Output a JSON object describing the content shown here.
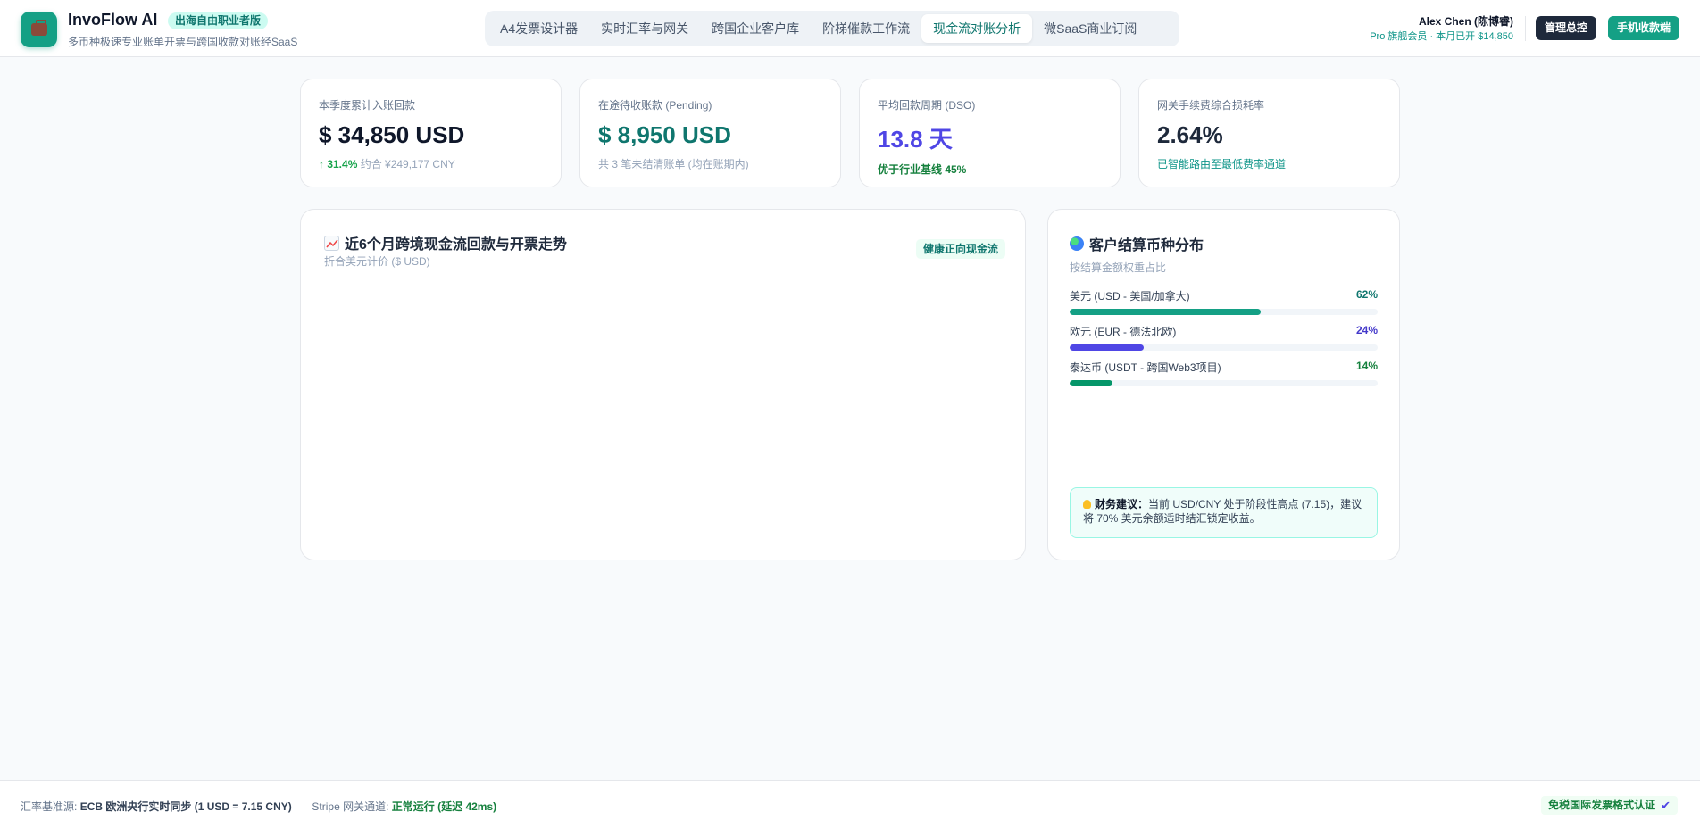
{
  "header": {
    "app_name": "InvoFlow AI",
    "edition_badge": "出海自由职业者版",
    "subtitle": "多币种极速专业账单开票与跨国收款对账经SaaS",
    "logo_icon": "briefcase-icon",
    "nav_tabs": [
      {
        "label": "A4发票设计器"
      },
      {
        "label": "实时汇率与网关"
      },
      {
        "label": "跨国企业客户库"
      },
      {
        "label": "阶梯催款工作流"
      },
      {
        "label": "现金流对账分析"
      },
      {
        "label": "微SaaS商业订阅"
      }
    ],
    "active_tab": "现金流对账分析",
    "user_name": "Alex Chen (陈博睿)",
    "user_plan": "Pro 旗舰会员 · 本月已开 $14,850",
    "admin_button": "管理总控",
    "mobile_button": "手机收款端"
  },
  "kpis": [
    {
      "label": "本季度累计入账回款",
      "value": "$ 34,850 USD",
      "foot_up": "↑ 31.4%",
      "foot_text": "约合 ¥249,177 CNY"
    },
    {
      "label": "在途待收账款 (Pending)",
      "value": "$ 8,950 USD",
      "foot_text": "共 3 笔未结清账单 (均在账期内)"
    },
    {
      "label": "平均回款周期 (DSO)",
      "value": "13.8 天",
      "foot_text": "优于行业基线 45%"
    },
    {
      "label": "网关手续费综合损耗率",
      "value": "2.64%",
      "foot_text": "已智能路由至最低费率通道"
    }
  ],
  "trend": {
    "title": "近6个月跨境现金流回款与开票走势",
    "subtitle": "折合美元计价 ($ USD)",
    "badge": "健康正向现金流",
    "icon": "chart-icon"
  },
  "currency": {
    "title": "客户结算币种分布",
    "subtitle": "按结算金额权重占比",
    "icon": "globe-icon",
    "rows": [
      {
        "label": "美元 (USD - 美国/加拿大)",
        "pct_text": "62%",
        "pct": 0.62,
        "color": "#14a085",
        "text_color": "#0f766e"
      },
      {
        "label": "欧元 (EUR - 德法北欧)",
        "pct_text": "24%",
        "pct": 0.24,
        "color": "#4f46e5",
        "text_color": "#4338ca"
      },
      {
        "label": "泰达币 (USDT - 跨国Web3项目)",
        "pct_text": "14%",
        "pct": 0.14,
        "color": "#059669",
        "text_color": "#15803d"
      }
    ],
    "advice_label": "财务建议：",
    "advice_text": "当前 USD/CNY 处于阶段性高点 (7.15)，建议将 70% 美元余额适时结汇锁定收益。"
  },
  "footer": {
    "rate_label": "汇率基准源:",
    "rate_value": "ECB 欧洲央行实时同步 (1 USD = 7.15 CNY)",
    "gateway_label": "Stripe 网关通道:",
    "gateway_value": "正常运行 (延迟 42ms)",
    "badge": "免税国际发票格式认证"
  }
}
